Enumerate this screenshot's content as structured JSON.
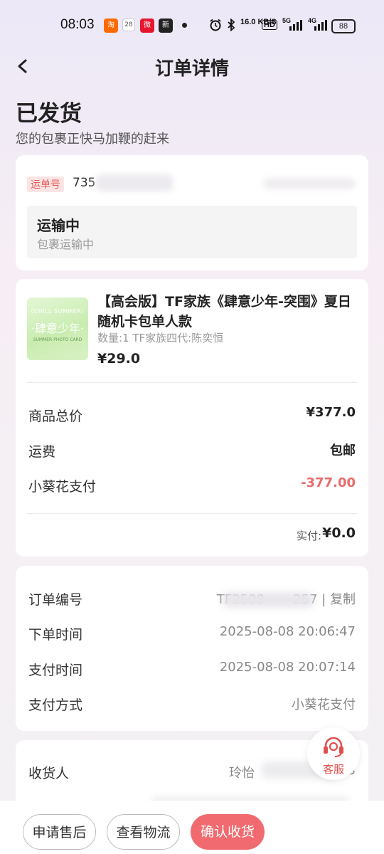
{
  "status_bar": {
    "time": "08:03",
    "apps": [
      {
        "icon": "taobao-icon",
        "label": "淘",
        "color": "#ff6a00"
      },
      {
        "icon": "calendar-icon",
        "label": "28",
        "color": "#888888"
      },
      {
        "icon": "weibo-icon",
        "label": "微",
        "color": "#e6162d"
      },
      {
        "icon": "news-icon",
        "label": "新",
        "color": "#222222"
      }
    ],
    "network_speed": "16.0 KB/S",
    "hd": "HD",
    "signal_5g": "5G",
    "signal_4g": "4G",
    "battery": "88"
  },
  "nav": {
    "title": "订单详情"
  },
  "status": {
    "title": "已发货",
    "subtitle": "您的包裹正快马加鞭的赶来"
  },
  "tracking": {
    "tag": "运单号",
    "number_visible": "735",
    "state_title": "运输中",
    "state_sub": "包裹运输中"
  },
  "product": {
    "thumb_line1": "〈CHILL SUMMER〉",
    "thumb_line2": "·肆意少年·",
    "thumb_line3": "SUMMER PHOTO CARD",
    "name": "【高会版】TF家族《肆意少年-突围》夏日随机卡包单人款",
    "spec": "数量:1 TF家族四代:陈奕恒",
    "price": "¥29.0"
  },
  "price_rows": [
    {
      "label": "商品总价",
      "value": "¥377.0"
    },
    {
      "label": "运费",
      "value": "包邮"
    },
    {
      "label": "小葵花支付",
      "value": "-377.00"
    }
  ],
  "paid": {
    "label": "实付:",
    "value": "¥0.0"
  },
  "order_info": [
    {
      "label": "订单编号",
      "value": "TF2508  ·  ·  ·  257 | 复制"
    },
    {
      "label": "下单时间",
      "value": "2025-08-08 20:06:47"
    },
    {
      "label": "支付时间",
      "value": "2025-08-08 20:07:14"
    },
    {
      "label": "支付方式",
      "value": "小葵花支付"
    }
  ],
  "receiver": {
    "label": "收货人",
    "value": "玲怡",
    "value_end": "3"
  },
  "service": {
    "label": "客服"
  },
  "actions": {
    "after_sale": "申请售后",
    "view_logistics": "查看物流",
    "confirm": "确认收货"
  }
}
